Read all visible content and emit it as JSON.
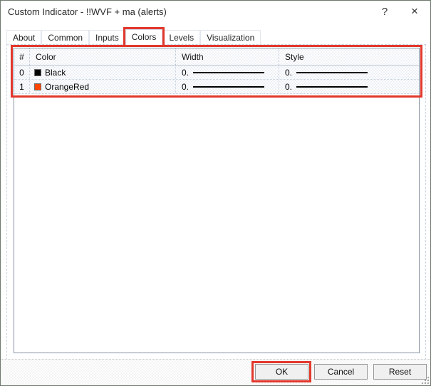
{
  "window": {
    "title": "Custom Indicator - !!WVF + ma (alerts)",
    "help_glyph": "?",
    "close_glyph": "×"
  },
  "tabs": {
    "items": [
      {
        "label": "About",
        "active": false
      },
      {
        "label": "Common",
        "active": false
      },
      {
        "label": "Inputs",
        "active": false
      },
      {
        "label": "Colors",
        "active": true
      },
      {
        "label": "Levels",
        "active": false
      },
      {
        "label": "Visualization",
        "active": false
      }
    ]
  },
  "colors_table": {
    "headers": {
      "index": "#",
      "color": "Color",
      "width": "Width",
      "style": "Style"
    },
    "rows": [
      {
        "index": "0",
        "color_name": "Black",
        "swatch": "#000000",
        "width_value": "0.",
        "style_value": "0."
      },
      {
        "index": "1",
        "color_name": "OrangeRed",
        "swatch": "#FF4500",
        "width_value": "0.",
        "style_value": "0."
      }
    ]
  },
  "buttons": {
    "ok": "OK",
    "cancel": "Cancel",
    "reset": "Reset"
  },
  "colors": {
    "annotation_red": "#e2382c",
    "list_border": "#8593a3",
    "window_border": "#6d796d",
    "line_preview": "#000000"
  }
}
